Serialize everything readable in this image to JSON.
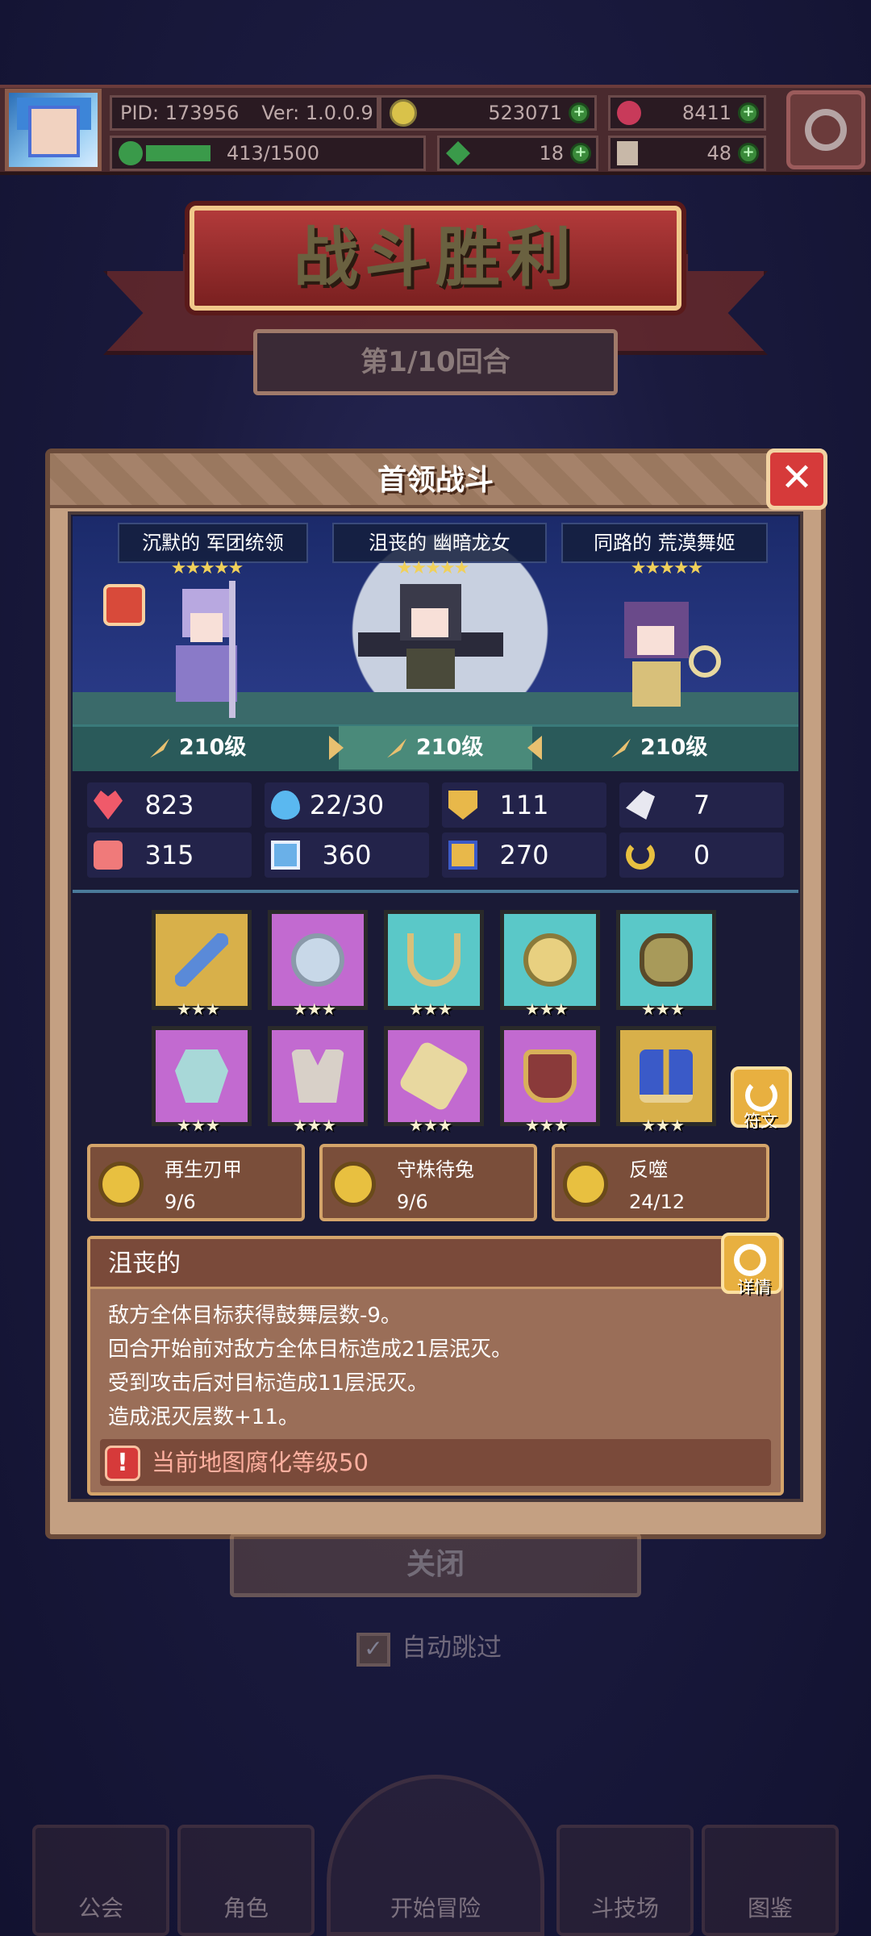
{
  "top_bar": {
    "pid": "PID: 173956",
    "version": "Ver: 1.0.0.9",
    "gold": "523071",
    "gems": "8411",
    "exp_text": "413/1500",
    "clover": "18",
    "keys": "48"
  },
  "victory": {
    "title": "战斗胜利",
    "round": "第1/10回合"
  },
  "dialog": {
    "title": "首领战斗",
    "heroes": [
      {
        "name": "沉默的 军团统领",
        "level": "210级"
      },
      {
        "name": "沮丧的 幽暗龙女",
        "level": "210级"
      },
      {
        "name": "同路的 荒漠舞姬",
        "level": "210级"
      }
    ],
    "stars_text": "★★★★★",
    "stats": {
      "hp": "823",
      "mana": "22/30",
      "armor": "111",
      "speed": "7",
      "attack": "315",
      "magic": "360",
      "defense": "270",
      "luck": "0"
    },
    "equipment_stars": "★★★",
    "rune_label": "符文",
    "traits": [
      {
        "name": "再生刃甲",
        "count": "9/6"
      },
      {
        "name": "守株待兔",
        "count": "9/6"
      },
      {
        "name": "反噬",
        "count": "24/12"
      }
    ],
    "description": {
      "title": "沮丧的",
      "detail_label": "详情",
      "lines": [
        "敌方全体目标获得鼓舞层数-9。",
        "回合开始前对敌方全体目标造成21层泯灭。",
        "受到攻击后对目标造成11层泯灭。",
        "造成泯灭层数+11。"
      ],
      "warning": "当前地图腐化等级50"
    }
  },
  "under_dialog": {
    "close_label": "关闭",
    "auto_skip_label": "自动跳过"
  },
  "bottom_nav": [
    "公会",
    "角色",
    "开始冒险",
    "斗技场",
    "图鉴"
  ]
}
